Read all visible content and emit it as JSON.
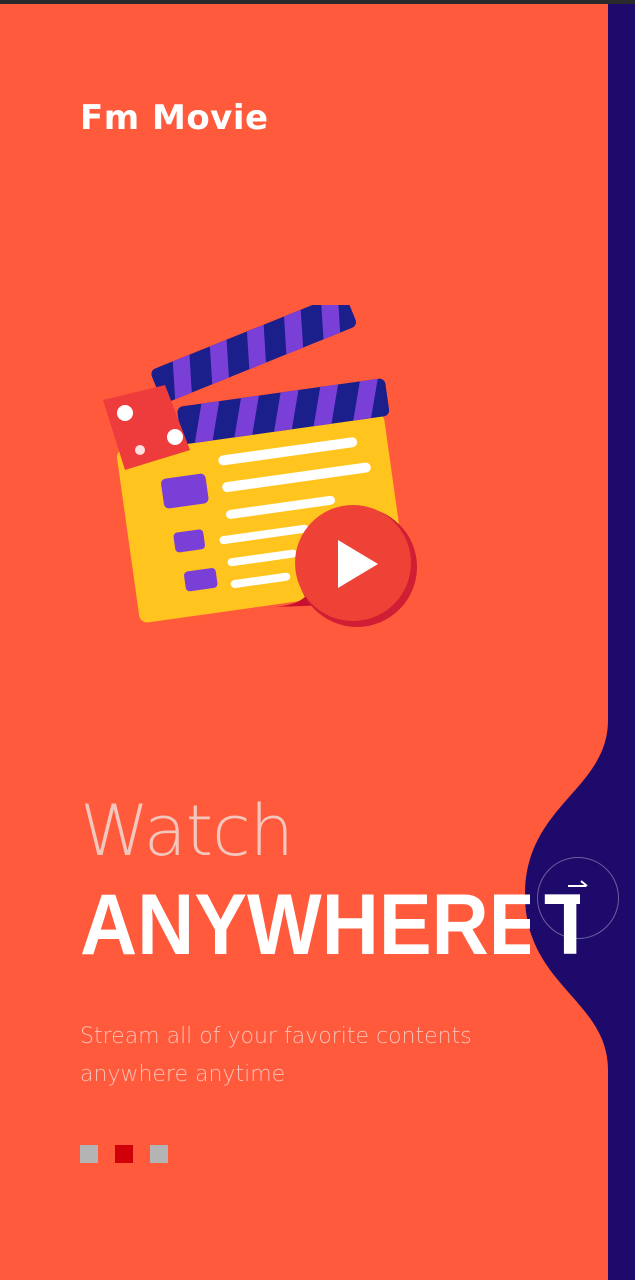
{
  "app": {
    "brand_name": "Fm Movie"
  },
  "onboarding": {
    "headline_light": "Watch",
    "headline_bold": "ANYWHERE",
    "headline_bold_reveal": "IT",
    "description_lines": [
      "Stream all of your favorite contents",
      "anywhere anytime"
    ],
    "pager": {
      "page_count": 3,
      "active_index": 1
    },
    "next_icon": "arrow-right-icon",
    "illustration_icon": "clapperboard-play-icon"
  },
  "colors": {
    "primary": "#ff5a3c",
    "secondary": "#1e0a6b",
    "dot_active": "#d0000a",
    "dot_inactive": "#b4b4b4"
  }
}
